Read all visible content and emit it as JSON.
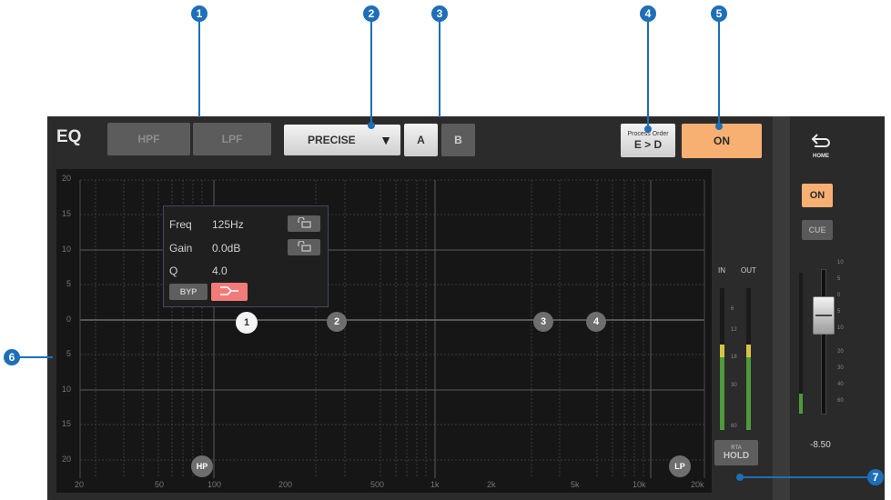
{
  "callouts": [
    "1",
    "2",
    "3",
    "4",
    "5",
    "6",
    "7"
  ],
  "header": {
    "title": "EQ",
    "hpf_label": "HPF",
    "lpf_label": "LPF",
    "mode_label": "PRECISE",
    "mode_arrow": "▼",
    "bank_a": "A",
    "bank_b": "B",
    "process_order_caption": "Process Order",
    "process_order_value": "E > D",
    "on_label": "ON"
  },
  "graph": {
    "y_labels": [
      "20",
      "15",
      "10",
      "5",
      "0",
      "5",
      "10",
      "15",
      "20"
    ],
    "x_labels": [
      "20",
      "50",
      "100",
      "200",
      "500",
      "1k",
      "2k",
      "5k",
      "10k",
      "20k"
    ]
  },
  "info": {
    "freq_label": "Freq",
    "freq_value": "125Hz",
    "gain_label": "Gain",
    "gain_value": "0.0dB",
    "q_label": "Q",
    "q_value": "4.0",
    "byp_label": "BYP"
  },
  "bands": {
    "b1": "1",
    "b2": "2",
    "b3": "3",
    "b4": "4",
    "hp": "HP",
    "lp": "LP"
  },
  "meter": {
    "in_label": "IN",
    "out_label": "OUT",
    "scale": [
      "6",
      "12",
      "18",
      "30",
      "60"
    ],
    "rta_caption": "RTA",
    "hold_label": "HOLD"
  },
  "side": {
    "home_label": "HOME",
    "on_label": "ON",
    "cue_label": "CUE",
    "fader_value": "-8.50",
    "fader_scale": [
      "10",
      "5",
      "0",
      "5",
      "10",
      "20",
      "30",
      "40",
      "60"
    ]
  },
  "colors": {
    "accent": "#1e6fb8",
    "on_button": "#f7b072",
    "phase_button": "#f07b78",
    "meter_green": "#4d9b3a",
    "meter_yellow": "#d6c545"
  }
}
